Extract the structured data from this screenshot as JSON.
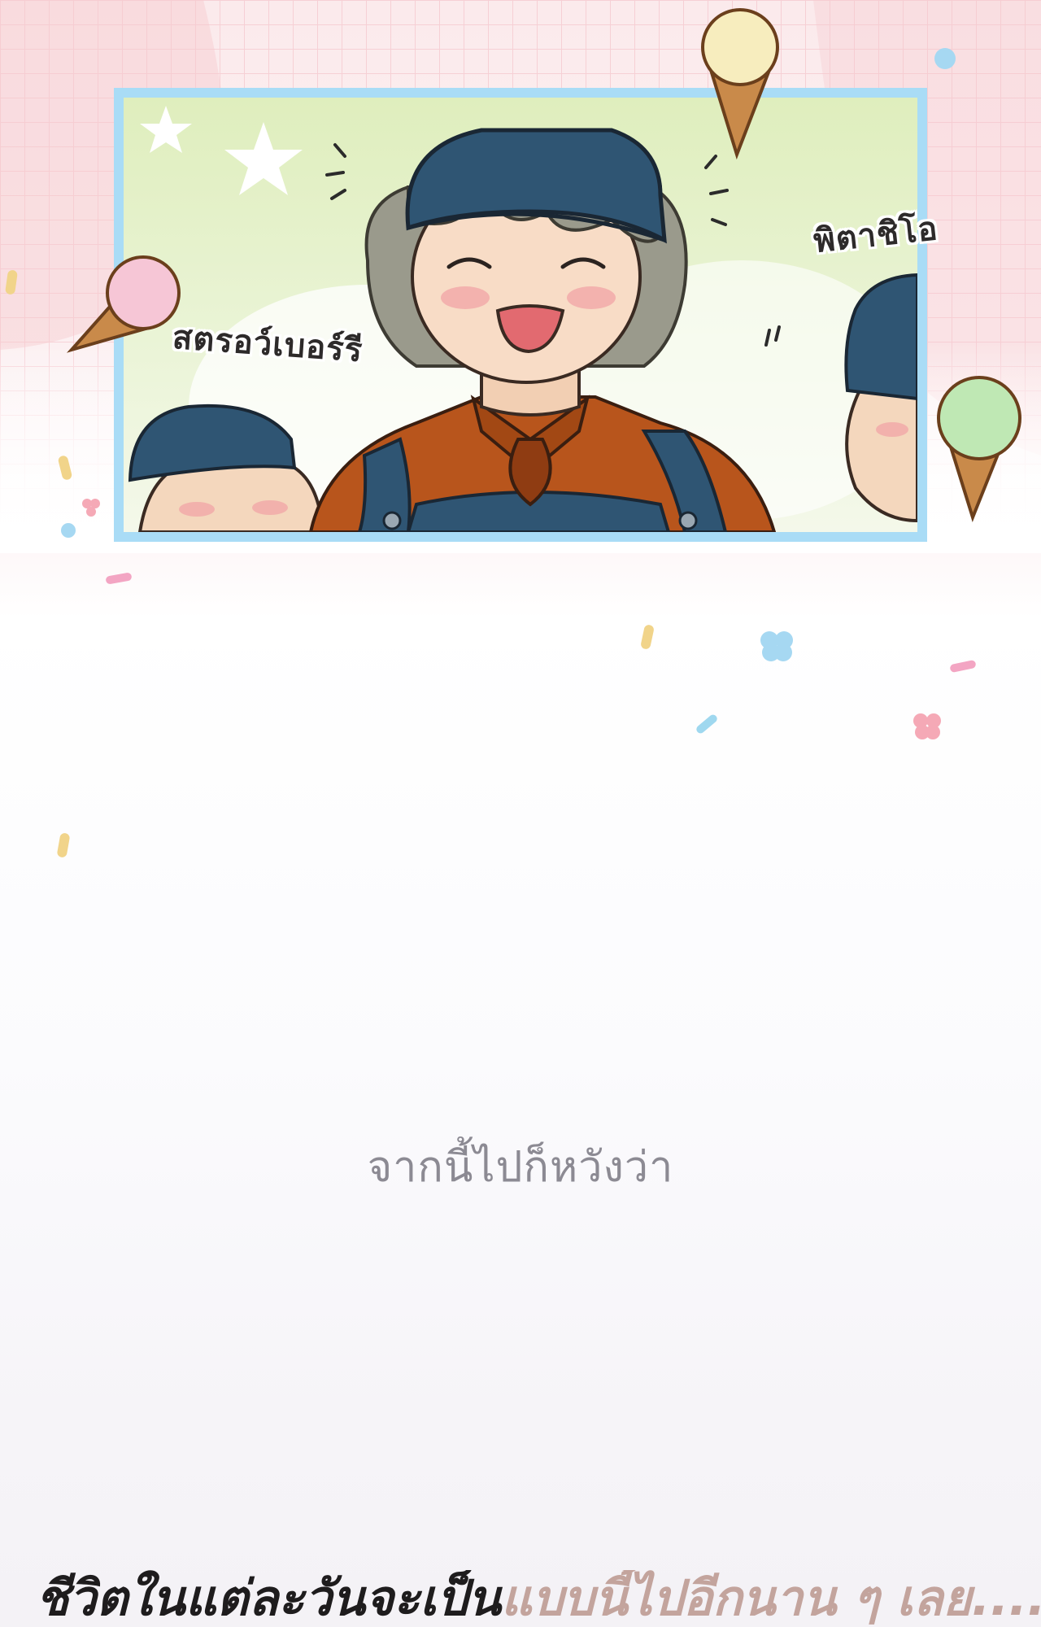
{
  "panel": {
    "sfx_left": "สตรอว์เบอร์รี",
    "sfx_right": "พิตาชิโอ"
  },
  "narration": {
    "caption": "จากนี้ไปก็หวังว่า",
    "bottom_part1": "ชีวิตในแต่ละวันจะเป็น",
    "bottom_part2": "แบบนี้ไปอีกนาน ๆ เลย......"
  },
  "colors": {
    "panel_border": "#a9dcf6",
    "cap": "#2f5573",
    "jacket": "#b8551c",
    "caption_text": "#8c8a93",
    "bottom_text": "#1e1c1d",
    "bottom_text_faded": "#c3a49d"
  }
}
